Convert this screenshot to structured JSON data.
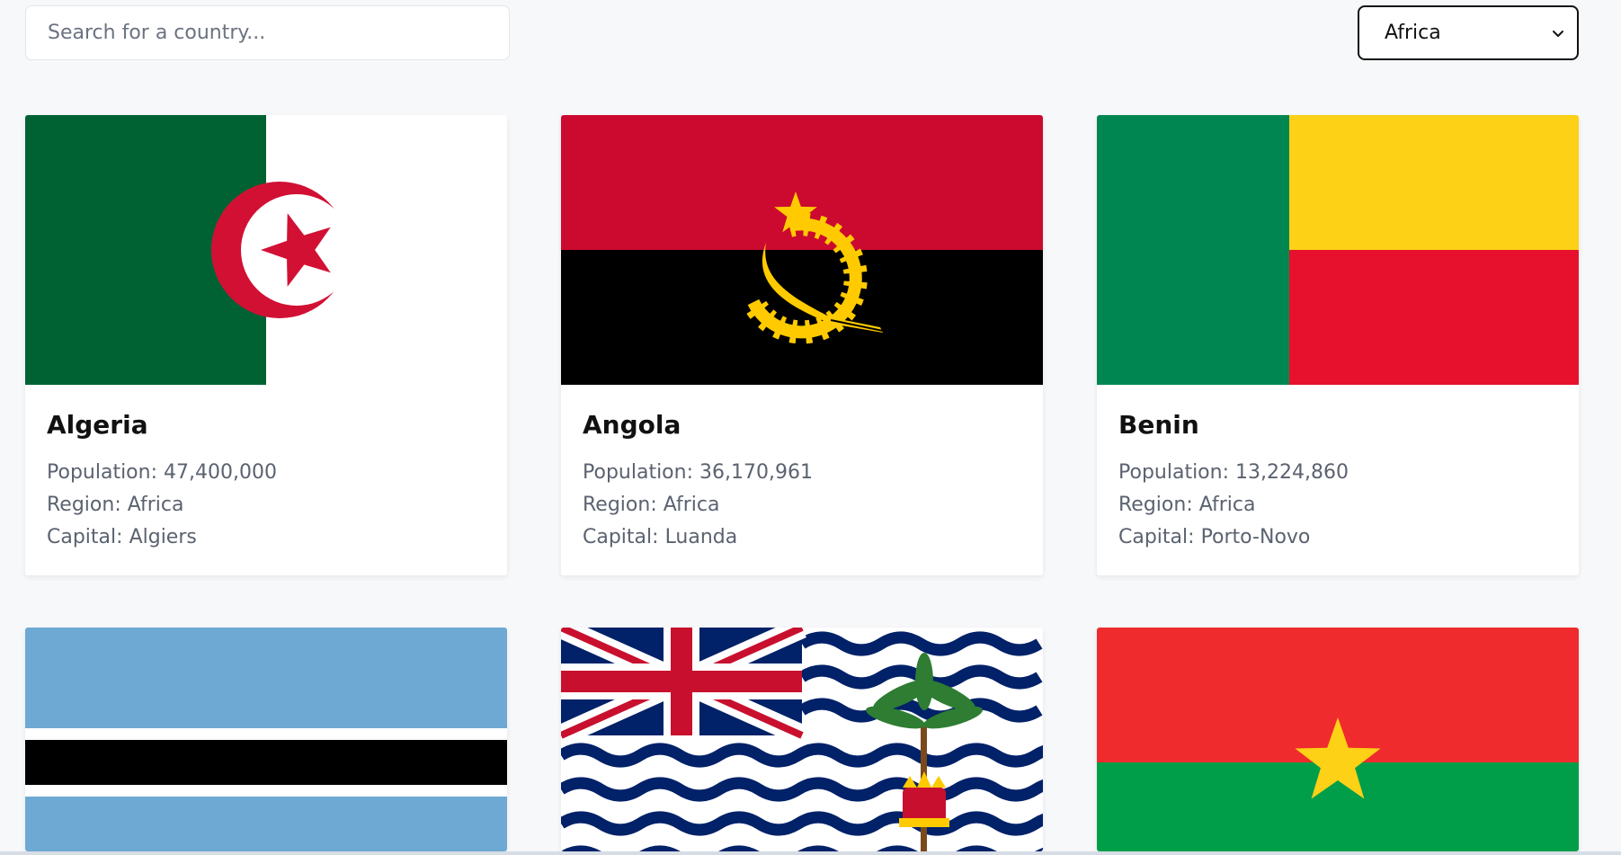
{
  "search": {
    "placeholder": "Search for a country..."
  },
  "region_filter": {
    "selected": "Africa"
  },
  "labels": {
    "population": "Population:",
    "region": "Region:",
    "capital": "Capital:"
  },
  "countries": [
    {
      "name": "Algeria",
      "population": "47,400,000",
      "region": "Africa",
      "capital": "Algiers"
    },
    {
      "name": "Angola",
      "population": "36,170,961",
      "region": "Africa",
      "capital": "Luanda"
    },
    {
      "name": "Benin",
      "population": "13,224,860",
      "region": "Africa",
      "capital": "Porto-Novo"
    }
  ],
  "colors": {
    "background": "#f7f8fa",
    "card": "#ffffff",
    "text_primary": "#111111",
    "text_secondary": "#5b6270"
  }
}
